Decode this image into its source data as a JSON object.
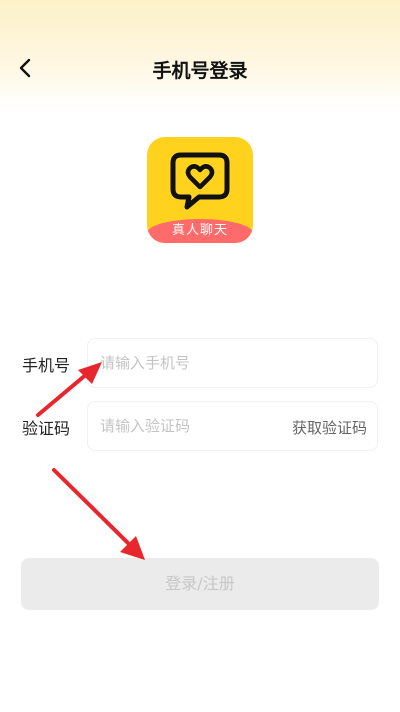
{
  "header": {
    "title": "手机号登录",
    "back_icon": "chevron-left-icon"
  },
  "logo": {
    "icon": "heart-chat-bubble-icon",
    "ribbon_text": "真人聊天",
    "bg_color": "#ffd21e",
    "ribbon_color": "#ff6b6b"
  },
  "form": {
    "phone": {
      "label": "手机号",
      "placeholder": "请输入手机号",
      "value": ""
    },
    "code": {
      "label": "验证码",
      "placeholder": "请输入验证码",
      "value": "",
      "get_code_label": "获取验证码"
    },
    "submit_label": "登录/注册"
  },
  "annotations": {
    "arrow_color": "#e8262b"
  }
}
